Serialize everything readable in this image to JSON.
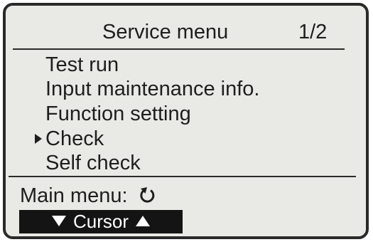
{
  "screen": {
    "title": "Service menu",
    "page_indicator": "1/2"
  },
  "menu": {
    "items": [
      {
        "label": "Test run",
        "selected": false
      },
      {
        "label": "Input maintenance info.",
        "selected": false
      },
      {
        "label": "Function setting",
        "selected": false
      },
      {
        "label": "Check",
        "selected": true
      },
      {
        "label": "Self check",
        "selected": false
      }
    ]
  },
  "footer": {
    "return_label": "Main menu:",
    "return_icon": "return-arrow-icon",
    "cursor_label": "Cursor",
    "cursor_down_icon": "down-triangle-icon",
    "cursor_up_icon": "up-triangle-icon"
  },
  "colors": {
    "lcd_background": "#e9e9e5",
    "text": "#1e1e1e",
    "highlight_bar": "#141414"
  }
}
